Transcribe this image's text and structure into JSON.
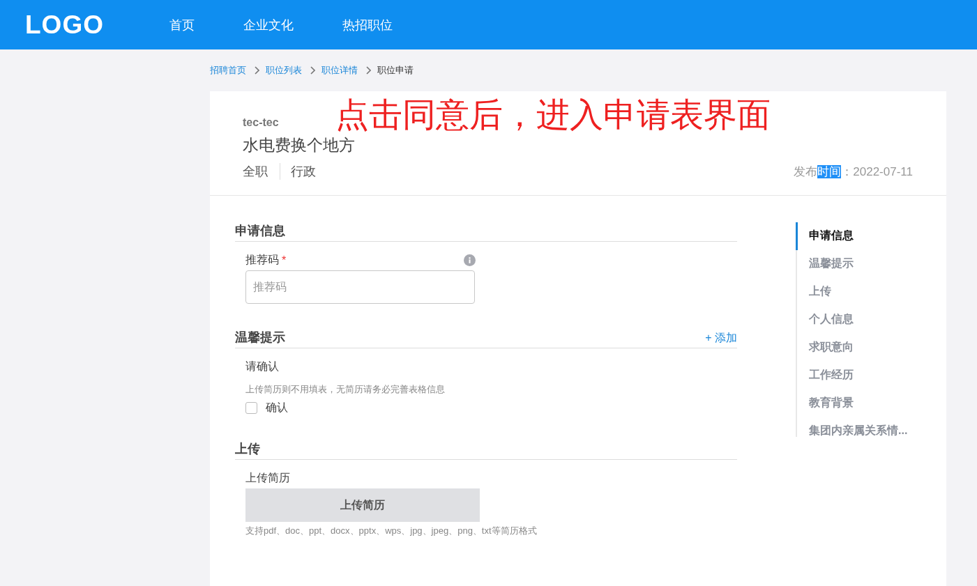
{
  "header": {
    "logo": "LOGO",
    "nav": [
      {
        "label": "首页"
      },
      {
        "label": "企业文化"
      },
      {
        "label": "热招职位"
      }
    ]
  },
  "breadcrumb": [
    {
      "label": "招聘首页",
      "current": false
    },
    {
      "label": "职位列表",
      "current": false
    },
    {
      "label": "职位详情",
      "current": false
    },
    {
      "label": "职位申请",
      "current": true
    }
  ],
  "job": {
    "company": "tec-tec",
    "title": "水电费换个地方",
    "tags": [
      "全职",
      "行政"
    ],
    "publish": [
      {
        "text": "发布",
        "selected": false
      },
      {
        "text": "时间",
        "selected": true
      },
      {
        "text": "：",
        "selected": false
      }
    ],
    "date": "2022-07-11"
  },
  "annotation": "点击同意后，进入申请表界面",
  "sections": [
    {
      "kind": "field",
      "title": "申请信息",
      "label": "推荐码",
      "required_mark": "*",
      "placeholder": "推荐码"
    },
    {
      "kind": "confirm",
      "title": "温馨提示",
      "action": "+ 添加",
      "label": "请确认",
      "hint": "上传简历则不用填表，无简历请务必完善表格信息",
      "checkbox": {
        "label": "确认",
        "checked": false
      }
    },
    {
      "kind": "upload",
      "title": "上传",
      "label": "上传简历",
      "button": "上传简历",
      "hint": "支持pdf、doc、ppt、docx、pptx、wps、jpg、jpeg、png、txt等简历格式"
    }
  ],
  "anchor_nav": [
    {
      "label": "申请信息",
      "selected": true
    },
    {
      "label": "温馨提示",
      "selected": false
    },
    {
      "label": "上传",
      "selected": false
    },
    {
      "label": "个人信息",
      "selected": false
    },
    {
      "label": "求职意向",
      "selected": false
    },
    {
      "label": "工作经历",
      "selected": false
    },
    {
      "label": "教育背景",
      "selected": false
    },
    {
      "label": "集团内亲属关系情...",
      "selected": false
    }
  ]
}
